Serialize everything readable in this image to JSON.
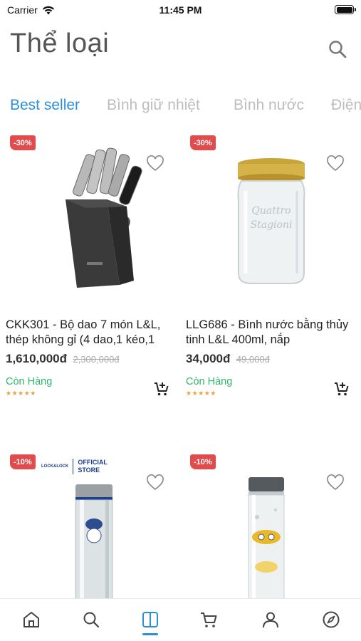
{
  "status_bar": {
    "carrier": "Carrier",
    "time": "11:45 PM"
  },
  "header": {
    "title": "Thể loại"
  },
  "tabs": [
    {
      "label": "Best seller",
      "active": true
    },
    {
      "label": "Bình giữ nhiệt",
      "active": false
    },
    {
      "label": "Bình nước",
      "active": false
    },
    {
      "label": "Điện",
      "active": false
    }
  ],
  "products": [
    {
      "badge": "-30%",
      "name": "CKK301 - Bộ dao 7 món L&L, thép không gỉ (4 dao,1 kéo,1",
      "price": "1,610,000đ",
      "old_price": "2,300,000đ",
      "stock": "Còn Hàng",
      "stars": "★★★★★"
    },
    {
      "badge": "-30%",
      "name": "LLG686 - Bình nước bằng thủy tinh L&L  400ml, nắp",
      "price": "34,000đ",
      "old_price": "49,000đ",
      "stock": "Còn Hàng",
      "stars": "★★★★★"
    },
    {
      "badge": "-10%",
      "official_logo": "LOCK&LOCK",
      "official_text_1": "OFFICIAL",
      "official_text_2": "STORE"
    },
    {
      "badge": "-10%"
    }
  ],
  "tabbar": {
    "items": [
      "home-icon",
      "search-icon",
      "book-icon",
      "cart-icon",
      "user-icon",
      "compass-icon"
    ],
    "active_index": 2,
    "accent": "#2c8fd8"
  },
  "colors": {
    "accent": "#2c8fd8",
    "badge": "#e24b4b",
    "in_stock": "#33b56b"
  }
}
